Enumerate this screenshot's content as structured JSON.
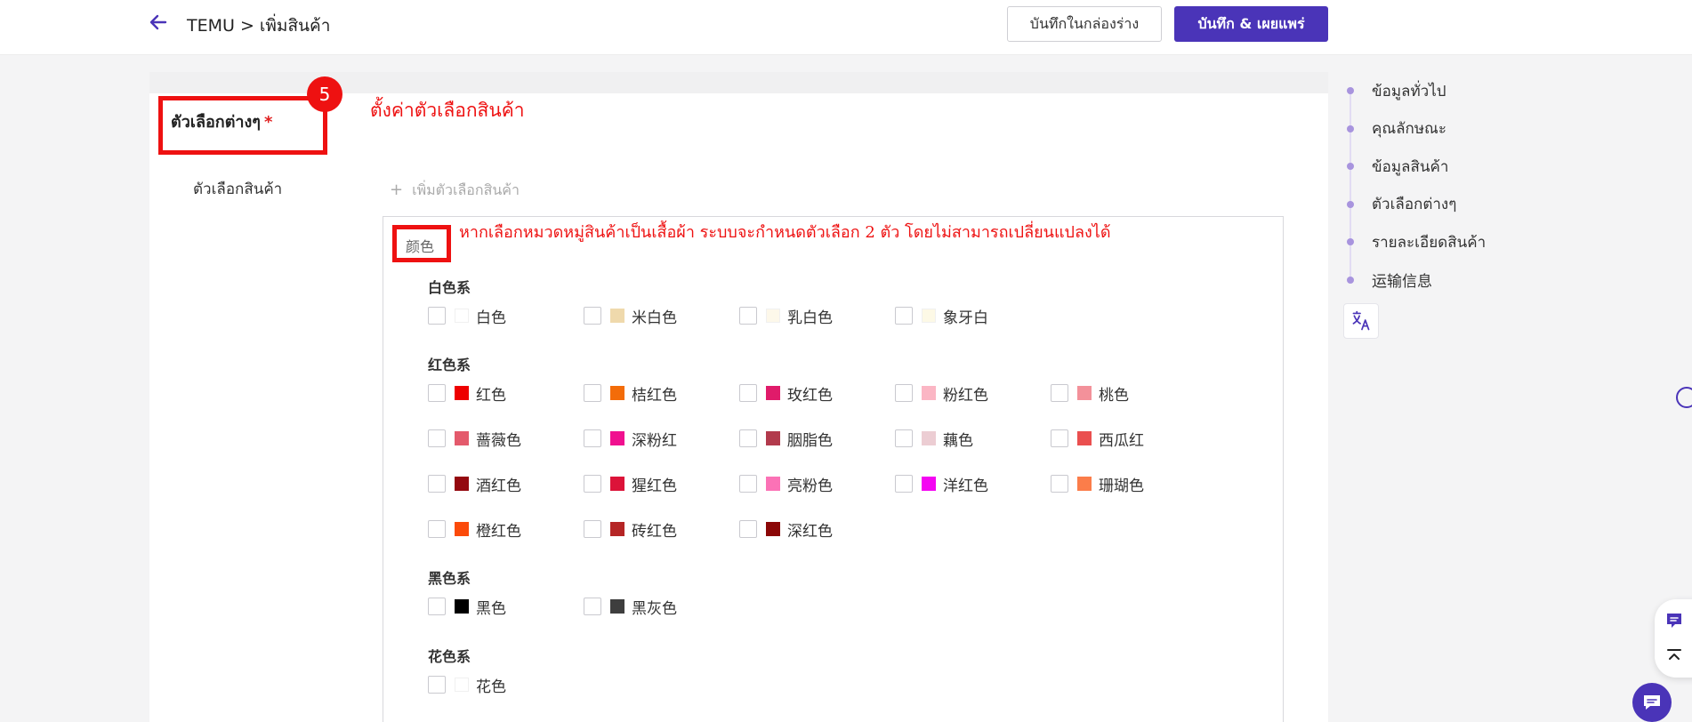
{
  "header": {
    "breadcrumb": "TEMU > เพิ่มสินค้า",
    "save_draft_label": "บันทึกในกล่องร่าง",
    "publish_label": "บันทึก & เผยแพร่"
  },
  "section": {
    "title": "ตัวเลือกต่างๆ",
    "required_mark": "*",
    "step_number": "5",
    "annotation": "ตั้งค่าตัวเลือกสินค้า",
    "field_label": "ตัวเลือกสินค้า",
    "add_option_label": "เพิ่มตัวเลือกสินค้า",
    "add_option_icon": "plus-icon"
  },
  "color_panel": {
    "tag": "颜色",
    "annotation": "หากเลือกหมวดหมู่สินค้าเป็นเสื้อผ้า ระบบจะกำหนดตัวเลือก 2 ตัว โดยไม่สามารถเปลี่ยนแปลงได้",
    "groups": [
      {
        "title": "白色系",
        "options": [
          {
            "label": "白色",
            "color": "#ffffff"
          },
          {
            "label": "米白色",
            "color": "#efd9ac"
          },
          {
            "label": "乳白色",
            "color": "#fdf8ea"
          },
          {
            "label": "象牙白",
            "color": "#fdf9e6"
          }
        ]
      },
      {
        "title": "红色系",
        "options": [
          {
            "label": "红色",
            "color": "#ee0000"
          },
          {
            "label": "桔红色",
            "color": "#f36c09"
          },
          {
            "label": "玫红色",
            "color": "#e01b6a"
          },
          {
            "label": "粉红色",
            "color": "#fbb6c4"
          },
          {
            "label": "桃色",
            "color": "#f3919a"
          },
          {
            "label": "蔷薇色",
            "color": "#e45a6c"
          },
          {
            "label": "深粉红",
            "color": "#f0108f"
          },
          {
            "label": "胭脂色",
            "color": "#b23a4c"
          },
          {
            "label": "藕色",
            "color": "#eccdd3"
          },
          {
            "label": "西瓜红",
            "color": "#ea4f4f"
          },
          {
            "label": "酒红色",
            "color": "#94080f"
          },
          {
            "label": "猩红色",
            "color": "#dc1339"
          },
          {
            "label": "亮粉色",
            "color": "#fb72b6"
          },
          {
            "label": "洋红色",
            "color": "#f405f2"
          },
          {
            "label": "珊瑚色",
            "color": "#fb7d4a"
          },
          {
            "label": "橙红色",
            "color": "#fb4a0a"
          },
          {
            "label": "砖红色",
            "color": "#b52525"
          },
          {
            "label": "深红色",
            "color": "#8b0707"
          }
        ]
      },
      {
        "title": "黑色系",
        "options": [
          {
            "label": "黑色",
            "color": "#000000"
          },
          {
            "label": "黑灰色",
            "color": "#3e3e3e"
          }
        ]
      },
      {
        "title": "花色系",
        "options": [
          {
            "label": "花色",
            "color": "#ffffff"
          }
        ]
      }
    ]
  },
  "side_nav": {
    "items": [
      "ข้อมูลทั่วไป",
      "คุณลักษณะ",
      "ข้อมูลสินค้า",
      "ตัวเลือกต่างๆ",
      "รายละเอียดสินค้า",
      "运输信息"
    ]
  },
  "icons": {
    "back": "back-arrow-icon",
    "translate": "translate-icon",
    "feedback": "feedback-icon",
    "scroll_top": "scroll-top-icon",
    "chat": "chat-icon"
  },
  "colors": {
    "brand": "#4a34b8",
    "annotation_red": "#ee1111"
  }
}
